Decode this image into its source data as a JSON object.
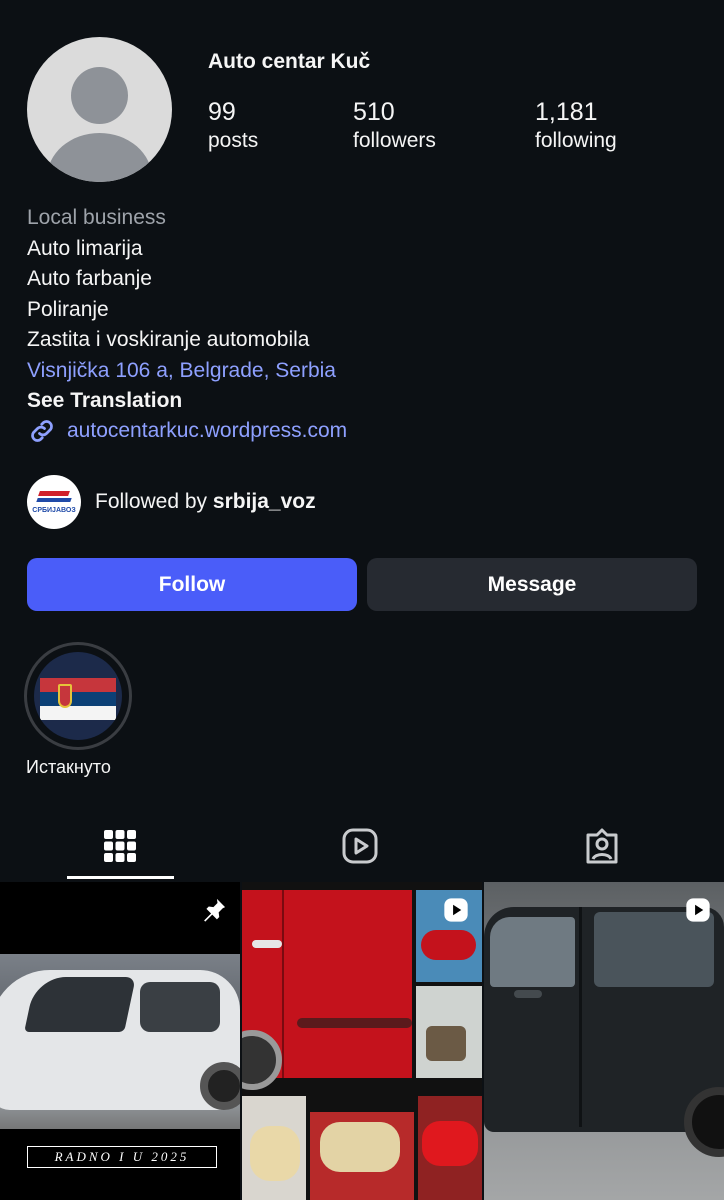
{
  "profile": {
    "name": "Auto centar Kuč",
    "stats": {
      "posts": {
        "value": "99",
        "label": "posts"
      },
      "followers": {
        "value": "510",
        "label": "followers"
      },
      "following": {
        "value": "1,181",
        "label": "following"
      }
    }
  },
  "bio": {
    "category": "Local business",
    "lines": [
      "Auto limarija",
      "Auto farbanje",
      "Poliranje",
      "Zastita i voskiranje automobila"
    ],
    "address": "Visnjička 106 a, Belgrade, Serbia",
    "see_translation": "See Translation",
    "website": "autocentarkuc.wordpress.com"
  },
  "followed_by": {
    "prefix": "Followed by",
    "username": "srbija_voz",
    "avatar_text": "СРБИЈАВОЗ"
  },
  "actions": {
    "follow": "Follow",
    "message": "Message"
  },
  "highlights": [
    {
      "label": "Истакнуто"
    }
  ],
  "tabs": [
    {
      "icon": "grid-icon",
      "active": true
    },
    {
      "icon": "reels-icon",
      "active": false
    },
    {
      "icon": "tagged-icon",
      "active": false
    }
  ],
  "posts": [
    {
      "type": "pinned",
      "icon": "pin-icon",
      "caption": "RADNO I U 2025"
    },
    {
      "type": "reel",
      "icon": "reel-play-icon"
    },
    {
      "type": "reel",
      "icon": "reel-play-icon"
    }
  ],
  "colors": {
    "background": "#0c1014",
    "accent": "#4a5df9",
    "link": "#8ea0ff",
    "secondary_button": "#262a31"
  }
}
